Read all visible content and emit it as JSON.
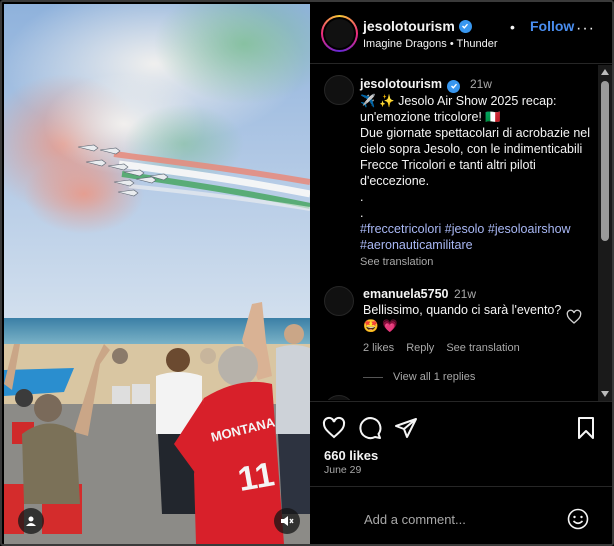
{
  "header": {
    "username": "jesolotourism",
    "dot": "•",
    "follow_label": "Follow",
    "more": "···",
    "music": "Imagine Dragons • Thunder"
  },
  "caption": {
    "username": "jesolotourism",
    "time": "21w",
    "line1": "✈️ ✨ Jesolo Air Show 2025 recap:",
    "line2": "un'emozione tricolore! 🇮🇹",
    "line3": "Due giornate spettacolari di acrobazie nel cielo sopra Jesolo, con le indimenticabili Frecce Tricolori e tanti altri piloti d'eccezione.",
    "dot1": ".",
    "dot2": ".",
    "hashtags": [
      "#freccetricolori",
      "#jesolo",
      "#jesoloairshow",
      "#aeronauticamilitare"
    ],
    "see_translation": "See translation"
  },
  "comment": {
    "username": "emanuela5750",
    "time": "21w",
    "text": "Bellissimo, quando ci sarà l'evento?",
    "emojis": "🤩 💗",
    "likes": "2 likes",
    "reply": "Reply",
    "see_translation": "See translation",
    "view_replies": "View all 1 replies"
  },
  "post": {
    "likes": "660 likes",
    "date": "June 29"
  },
  "add_comment": {
    "placeholder": "Add a comment..."
  },
  "photo": {
    "jersey_name": "MONTANA",
    "jersey_number": "11"
  },
  "icons": [
    "heart-icon",
    "comment-icon",
    "share-icon",
    "bookmark-icon",
    "emoji-icon",
    "verified-icon",
    "user-tag-icon",
    "muted-speaker-icon"
  ],
  "colors": {
    "follow": "#4a8ef0",
    "hashtag": "#a9b8f5",
    "verified": "#3897f0",
    "muted_text": "#a8a8a8"
  }
}
